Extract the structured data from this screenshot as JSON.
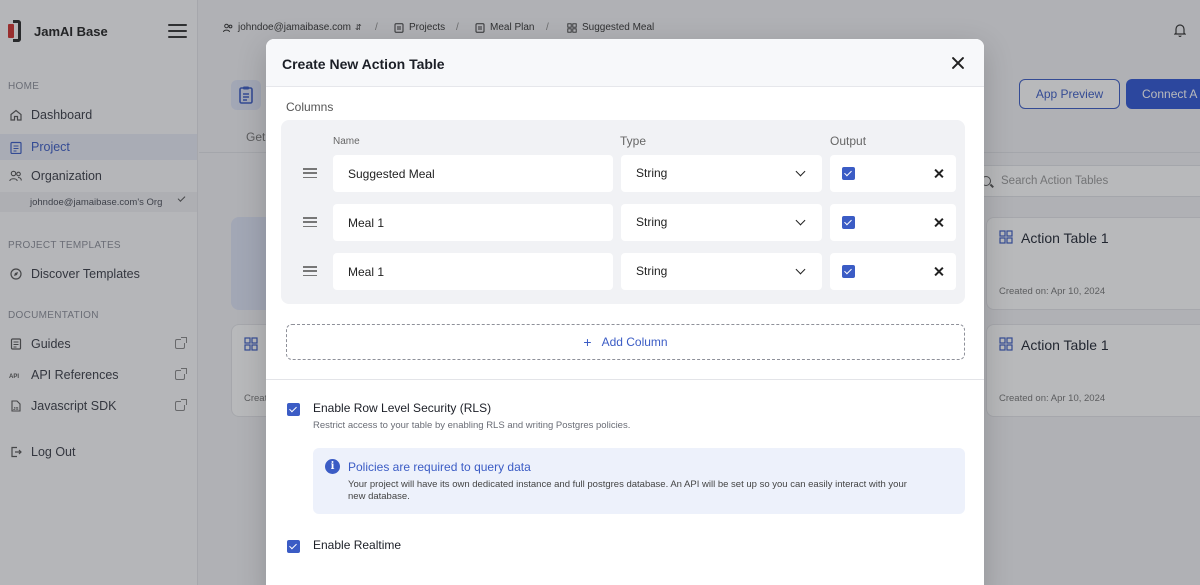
{
  "sidebar": {
    "brand": "JamAI Base",
    "sections": {
      "home": "HOME",
      "templates": "PROJECT TEMPLATES",
      "docs": "DOCUMENTATION"
    },
    "items": {
      "dashboard": "Dashboard",
      "project": "Project",
      "organization": "Organization",
      "org_selected": "johndoe@jamaibase.com's Org",
      "discover": "Discover Templates",
      "guides": "Guides",
      "api_ref": "API References",
      "js_sdk": "Javascript SDK",
      "logout": "Log Out"
    }
  },
  "breadcrumb": {
    "user": "johndoe@jamaibase.com",
    "projects": "Projects",
    "meal_plan": "Meal Plan",
    "suggested_meal": "Suggested Meal"
  },
  "background": {
    "tab_partial": "Get",
    "app_preview": "App Preview",
    "connect": "Connect A",
    "search_placeholder": "Search Action Tables",
    "cards": [
      {
        "title": "Action Table 1",
        "date": "Created on: Apr 10, 2024"
      },
      {
        "title": "Action Table 1",
        "date": "Created on: Apr 10, 2024"
      }
    ],
    "left_card_date_partial": "Creat"
  },
  "modal": {
    "title": "Create New Action Table",
    "columns_label": "Columns",
    "headers": {
      "name": "Name",
      "type": "Type",
      "output": "Output"
    },
    "rows": [
      {
        "name": "Suggested Meal",
        "type": "String",
        "output": true
      },
      {
        "name": "Meal 1",
        "type": "String",
        "output": true
      },
      {
        "name": "Meal 1",
        "type": "String",
        "output": true
      }
    ],
    "add_column": "Add Column",
    "rls": {
      "label": "Enable Row Level Security (RLS)",
      "desc": "Restrict access to your table by enabling RLS and writing Postgres policies.",
      "checked": true
    },
    "callout": {
      "title": "Policies are required to query data",
      "body": "Your project will have its own dedicated instance and full postgres database. An API will be set up so you can easily interact with your new database."
    },
    "realtime": {
      "label": "Enable Realtime",
      "checked": true
    }
  },
  "colors": {
    "accent": "#3b5cc5",
    "primary_button": "#2f55d4",
    "overlay": "rgba(40,42,50,0.33)"
  }
}
